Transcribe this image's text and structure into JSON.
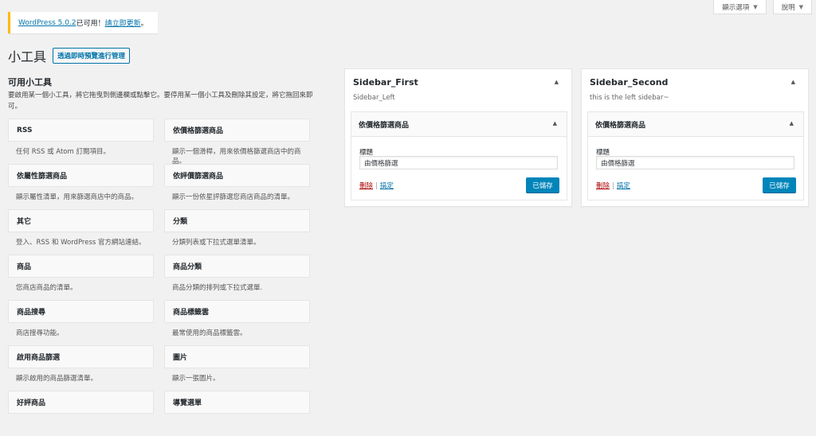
{
  "screen_meta": {
    "options_label": "顯示選項",
    "help_label": "說明"
  },
  "notice": {
    "update_link": "WordPress 5.0.2",
    "text_middle": " 已可用！",
    "update_now": "請立即更新",
    "text_end": "。"
  },
  "page": {
    "title": "小工具",
    "customizer_button": "透過即時預覽進行管理"
  },
  "available": {
    "title": "可用小工具",
    "description": "要啟用某一個小工具，將它拖曳到側邊欄或點擊它。要停用某一個小工具及刪除其設定，將它拖回來即可。",
    "widgets": [
      {
        "name": "RSS",
        "desc": "任何 RSS 或 Atom 訂閱項目。"
      },
      {
        "name": "依價格篩選商品",
        "desc": "顯示一個滑桿，用來依價格篩選商店中的商品。"
      },
      {
        "name": "依屬性篩選商品",
        "desc": "顯示屬性清單，用來篩選商店中的商品。"
      },
      {
        "name": "依評價篩選商品",
        "desc": "顯示一份依星評篩選您商店商品的清單。"
      },
      {
        "name": "其它",
        "desc": "登入、RSS 和 WordPress 官方網站連結。"
      },
      {
        "name": "分類",
        "desc": "分類列表或下拉式選單清單。"
      },
      {
        "name": "商品",
        "desc": "您商店商品的清單。"
      },
      {
        "name": "商品分類",
        "desc": "商品分類的排列或下拉式選單."
      },
      {
        "name": "商品搜尋",
        "desc": "商店搜尋功能。"
      },
      {
        "name": "商品標籤雲",
        "desc": "最常使用的商品標籤雲。"
      },
      {
        "name": "啟用商品篩選",
        "desc": "顯示啟用的商品篩選清單。"
      },
      {
        "name": "圖片",
        "desc": "顯示一張圖片。"
      },
      {
        "name": "好評商品",
        "desc": ""
      },
      {
        "name": "導覽選單",
        "desc": ""
      }
    ]
  },
  "sidebars": [
    {
      "title": "Sidebar_First",
      "description": "Sidebar_Left",
      "widget": {
        "title": "依價格篩選商品",
        "field_label": "標題",
        "field_value": "由價格篩選",
        "delete_label": "刪除",
        "done_label": "搞定",
        "save_label": "已儲存"
      }
    },
    {
      "title": "Sidebar_Second",
      "description": "this is the left sidebar~",
      "widget": {
        "title": "依價格篩選商品",
        "field_label": "標題",
        "field_value": "由價格篩選",
        "delete_label": "刪除",
        "done_label": "搞定",
        "save_label": "已儲存"
      }
    }
  ]
}
